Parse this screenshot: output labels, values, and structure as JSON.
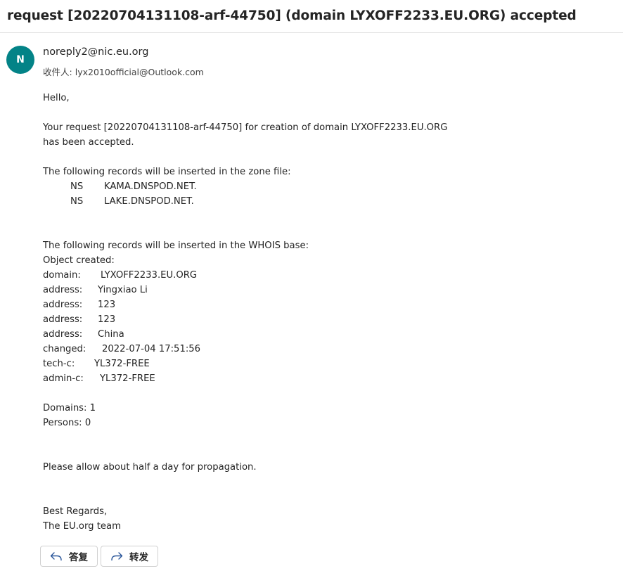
{
  "email": {
    "subject": "request [20220704131108-arf-44750] (domain LYXOFF2233.EU.ORG) accepted",
    "avatar_initial": "N",
    "avatar_color": "#038387",
    "sender": "noreply2@nic.eu.org",
    "recipient_label": "收件人:",
    "recipient": "lyx2010official@Outlook.com"
  },
  "body": {
    "greeting": "Hello,",
    "para1_line1": "Your request [20220704131108-arf-44750] for creation of domain LYXOFF2233.EU.ORG",
    "para1_line2": "has been accepted.",
    "zone_intro": "The following records will be inserted in the zone file:",
    "ns_records": [
      {
        "type": "NS",
        "value": "KAMA.DNSPOD.NET."
      },
      {
        "type": "NS",
        "value": "LAKE.DNSPOD.NET."
      }
    ],
    "whois_intro": "The following records will be inserted in the WHOIS base:",
    "object_created": "Object created:",
    "whois": [
      {
        "key": "domain:",
        "value": "LYXOFF2233.EU.ORG"
      },
      {
        "key": "address:",
        "value": "Yingxiao Li"
      },
      {
        "key": "address:",
        "value": "123"
      },
      {
        "key": "address:",
        "value": "123"
      },
      {
        "key": "address:",
        "value": "China"
      },
      {
        "key": "changed:",
        "value": "2022-07-04 17:51:56"
      },
      {
        "key": "tech-c:",
        "value": "YL372-FREE"
      },
      {
        "key": "admin-c:",
        "value": "YL372-FREE"
      }
    ],
    "domains_count": "Domains: 1",
    "persons_count": "Persons: 0",
    "propagation": "Please allow about half a day for propagation.",
    "regards": "Best Regards,",
    "team": "The EU.org team"
  },
  "actions": {
    "reply_label": "答复",
    "forward_label": "转发",
    "reply_icon": "reply-arrow-icon",
    "forward_icon": "forward-arrow-icon"
  }
}
